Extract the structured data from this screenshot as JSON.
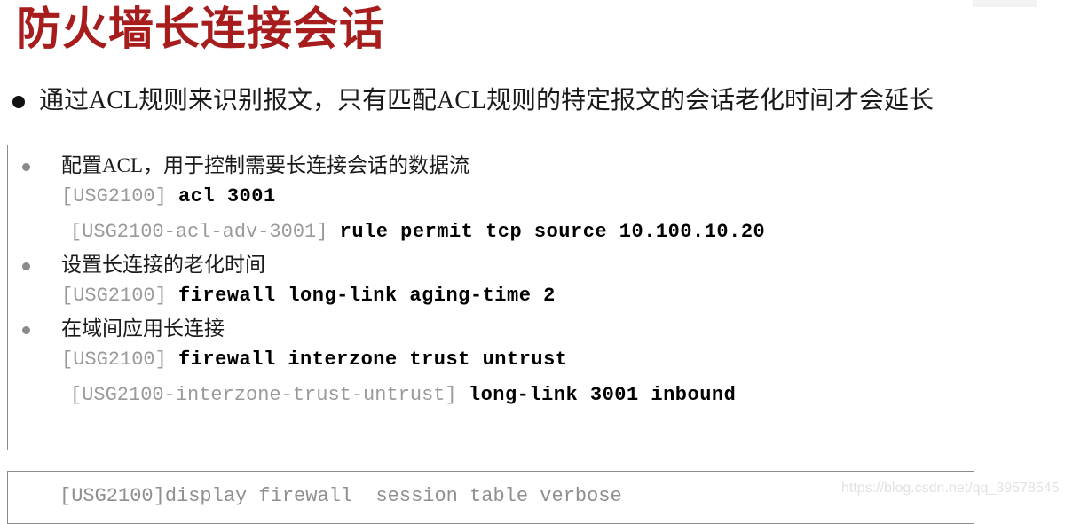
{
  "slide": {
    "title": "防火墙长连接会话",
    "title_color": "#a71c1c",
    "lead_bullet": "通过ACL规则来识别报文，只有匹配ACL规则的特定报文的会话老化时间才会延长"
  },
  "config_panel": {
    "items": [
      {
        "heading": "配置ACL，用于控制需要长连接会话的数据流",
        "lines": [
          {
            "prompt": "[USG2100]",
            "command": "acl 3001",
            "indent": 1
          },
          {
            "prompt": "[USG2100-acl-adv-3001]",
            "command": "rule permit tcp source 10.100.10.20",
            "indent": 2
          }
        ]
      },
      {
        "heading": "设置长连接的老化时间",
        "lines": [
          {
            "prompt": "[USG2100]",
            "command": "firewall long-link aging-time 2",
            "indent": 1
          }
        ]
      },
      {
        "heading": "在域间应用长连接",
        "lines": [
          {
            "prompt": "[USG2100]",
            "command": "firewall interzone trust untrust",
            "indent": 1
          },
          {
            "prompt": "[USG2100-interzone-trust-untrust]",
            "command": "long-link 3001 inbound",
            "indent": 2
          }
        ]
      }
    ]
  },
  "display_panel": {
    "line": "[USG2100]display firewall  session table verbose"
  },
  "watermark": {
    "text": "https://blog.csdn.net/qq_39578545"
  }
}
